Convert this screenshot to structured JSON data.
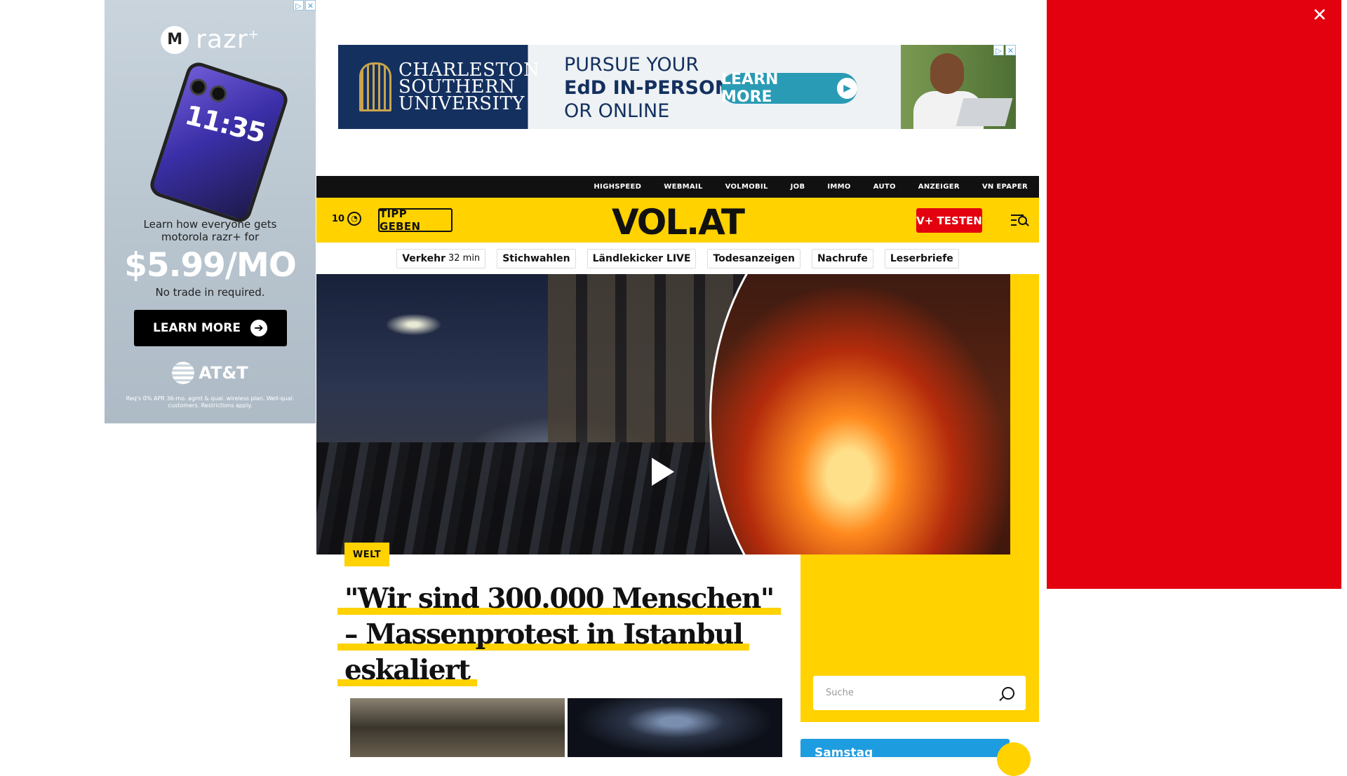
{
  "left_ad": {
    "brand": "razr",
    "brand_mark": "+",
    "phone_time": "11:35",
    "copy": "Learn how everyone gets motorola razr+ for",
    "price": "$5.99/MO",
    "trade": "No trade in required.",
    "cta": "LEARN MORE",
    "carrier": "AT&T",
    "fine_print": "Req's 0% APR 36-mo. agmt & qual. wireless plan. Well-qual. customers. Restrictions apply."
  },
  "top_banner": {
    "school_name": "CHARLESTON SOUTHERN UNIVERSITY",
    "line1": "PURSUE YOUR",
    "line2": "EdD IN-PERSON",
    "line3": "OR ONLINE",
    "cta": "LEARN MORE"
  },
  "service_links": [
    "HIGHSPEED",
    "WEBMAIL",
    "VOLMOBIL",
    "JOB",
    "IMMO",
    "AUTO",
    "ANZEIGER",
    "VN EPAPER"
  ],
  "header": {
    "temperature": "10",
    "tipp_label": "TIPP GEBEN",
    "logo": "VOL.AT",
    "vplus_label": "V+ TESTEN"
  },
  "quick_links": {
    "verkehr_label": "Verkehr",
    "verkehr_time": "32 min",
    "items": [
      "Stichwahlen",
      "Ländlekicker LIVE",
      "Todesanzeigen",
      "Nachrufe",
      "Leserbriefe"
    ]
  },
  "article": {
    "category": "WELT",
    "headline": "\"Wir sind 300.000 Menschen\" – Massenprotest in Istanbul eskaliert"
  },
  "search": {
    "placeholder": "Suche"
  },
  "weather_card": {
    "day": "Samstag"
  },
  "colors": {
    "brand_yellow": "#ffd200",
    "brand_red": "#e3000f",
    "service_bar": "#111111"
  }
}
